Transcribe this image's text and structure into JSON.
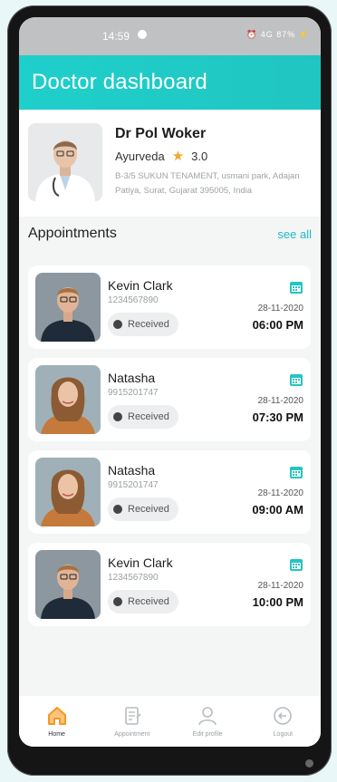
{
  "status_bar": {
    "time": "14:59",
    "right_indicators": "⏰ 4G 87% ⚡"
  },
  "header": {
    "title": "Doctor dashboard"
  },
  "doctor": {
    "name": "Dr Pol Woker",
    "specialty": "Ayurveda",
    "rating": "3.0",
    "address": "B-3/5 SUKUN TENAMENT, usmani park, Adajan Patiya, Surat, Gujarat 395005, India"
  },
  "appointments_section": {
    "title": "Appointments",
    "see_all": "see all"
  },
  "appointments": [
    {
      "name": "Kevin Clark",
      "phone": "1234567890",
      "status": "Received",
      "date": "28-11-2020",
      "time": "06:00 PM"
    },
    {
      "name": "Natasha",
      "phone": "9915201747",
      "status": "Received",
      "date": "28-11-2020",
      "time": "07:30 PM"
    },
    {
      "name": "Natasha",
      "phone": "9915201747",
      "status": "Received",
      "date": "28-11-2020",
      "time": "09:00 AM"
    },
    {
      "name": "Kevin Clark",
      "phone": "1234567890",
      "status": "Received",
      "date": "28-11-2020",
      "time": "10:00 PM"
    }
  ],
  "tabs": [
    {
      "label": "Home",
      "icon": "home-icon",
      "active": true
    },
    {
      "label": "Appointment",
      "icon": "appointment-icon",
      "active": false
    },
    {
      "label": "Edit profile",
      "icon": "user-icon",
      "active": false
    },
    {
      "label": "Logout",
      "icon": "logout-icon",
      "active": false
    }
  ],
  "colors": {
    "accent": "#1fcfcb",
    "link": "#1fb9c9",
    "home_icon": "#f39a23"
  }
}
